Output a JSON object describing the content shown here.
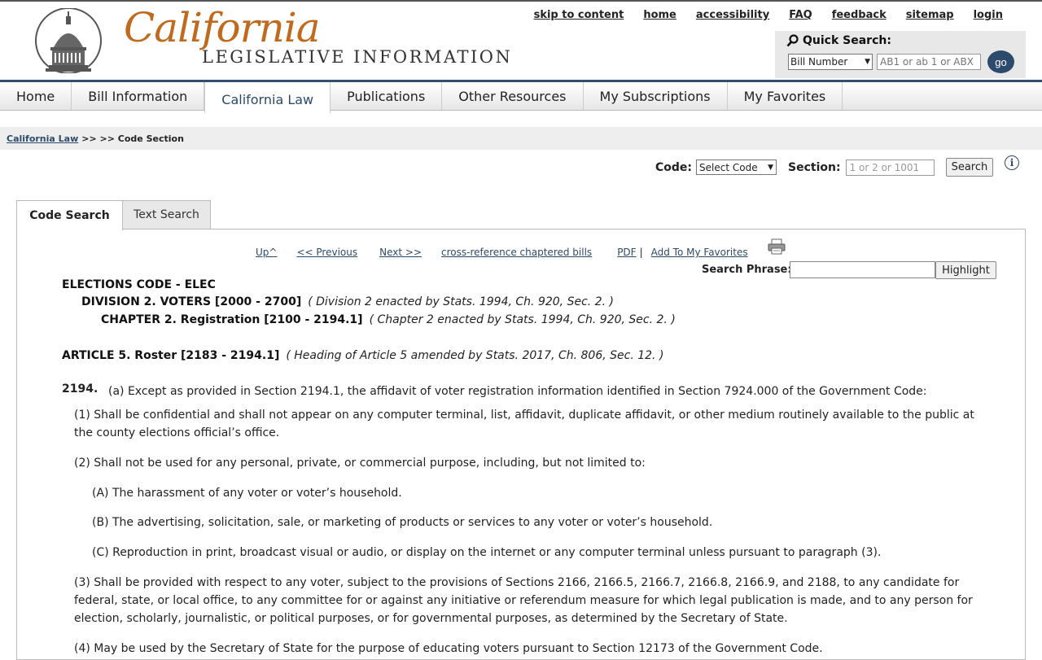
{
  "logo": {
    "script": "California",
    "sub": "LEGISLATIVE INFORMATION"
  },
  "toplinks": [
    "skip to content",
    "home",
    "accessibility",
    "FAQ",
    "feedback",
    "sitemap",
    "login"
  ],
  "quick_search": {
    "title": "Quick Search:",
    "select_value": "Bill Number",
    "placeholder": "AB1 or ab 1 or ABX",
    "go_label": "go"
  },
  "nav": [
    "Home",
    "Bill Information",
    "California Law",
    "Publications",
    "Other Resources",
    "My Subscriptions",
    "My Favorites"
  ],
  "breadcrumb": {
    "link": "California Law",
    "rest": ">> >> Code Section"
  },
  "code_search": {
    "code_label": "Code:",
    "code_value": "Select Code",
    "section_label": "Section:",
    "section_placeholder": "1 or 2 or 1001",
    "search_label": "Search"
  },
  "tabs": {
    "active": "Code Search",
    "inactive": "Text Search"
  },
  "sublinks": {
    "up": "Up^",
    "previous": "<< Previous",
    "next": "Next >>",
    "cross": "cross-reference chaptered bills",
    "pdf": "PDF",
    "sep": "|",
    "favorites": "Add To My Favorites"
  },
  "search_phrase": {
    "label": "Search Phrase:",
    "button": "Highlight"
  },
  "headings": {
    "code": "ELECTIONS CODE - ELEC",
    "division": "DIVISION 2. VOTERS [2000 - 2700]",
    "division_note": "( Division 2 enacted by Stats. 1994, Ch. 920, Sec. 2. )",
    "chapter": "CHAPTER 2. Registration [2100 - 2194.1]",
    "chapter_note": "( Chapter 2 enacted by Stats. 1994, Ch. 920, Sec. 2. )",
    "article": "ARTICLE 5. Roster [2183 - 2194.1]",
    "article_note": "( Heading of Article 5 amended by Stats. 2017, Ch. 806, Sec. 12. )"
  },
  "section": {
    "number": "2194.",
    "a": "(a) Except as provided in Section 2194.1, the affidavit of voter registration information identified in Section 7924.000 of the Government Code:",
    "p1": "(1) Shall be confidential and shall not appear on any computer terminal, list, affidavit, duplicate affidavit, or other medium routinely available to the public at the county elections official’s office.",
    "p2": "(2) Shall not be used for any personal, private, or commercial purpose, including, but not limited to:",
    "pA": "(A) The harassment of any voter or voter’s household.",
    "pB": "(B) The advertising, solicitation, sale, or marketing of products or services to any voter or voter’s household.",
    "pC": "(C) Reproduction in print, broadcast visual or audio, or display on the internet or any computer terminal unless pursuant to paragraph (3).",
    "p3": "(3) Shall be provided with respect to any voter, subject to the provisions of Sections 2166, 2166.5, 2166.7, 2166.8, 2166.9, and 2188, to any candidate for federal, state, or local office, to any committee for or against any initiative or referendum measure for which legal publication is made, and to any person for election, scholarly, journalistic, or political purposes, or for governmental purposes, as determined by the Secretary of State.",
    "p4": "(4) May be used by the Secretary of State for the purpose of educating voters pursuant to Section 12173 of the Government Code."
  }
}
